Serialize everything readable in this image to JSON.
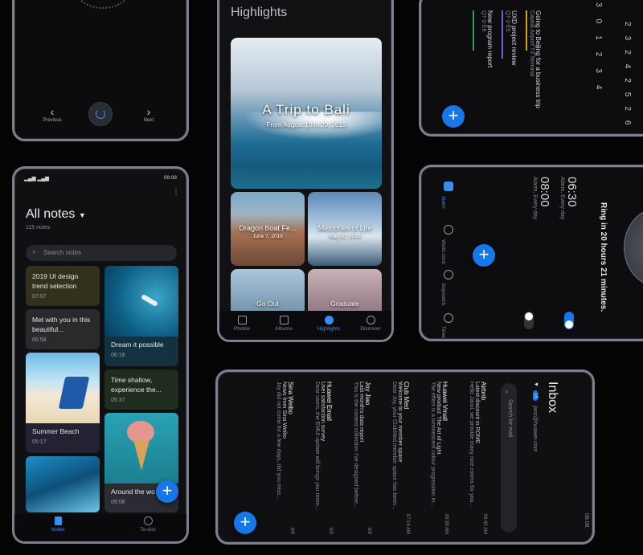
{
  "player": {
    "prev_label": "Previous",
    "next_label": "Next"
  },
  "notes": {
    "status_time": "08:08",
    "title": "All notes",
    "count": "115 notes",
    "search_placeholder": "Search notes",
    "items": [
      {
        "title": "2019 UI design trend selection",
        "date": "07:07"
      },
      {
        "title": "Met with you in this beautiful...",
        "date": "06:58"
      },
      {
        "title": "Summer Beach",
        "date": "05:17"
      },
      {
        "title": "Dream it possible",
        "date": "06:18"
      },
      {
        "title": "Time shallow, experience the...",
        "date": "05:37"
      },
      {
        "title": "Around the wo",
        "date": "09:08"
      }
    ],
    "tabs": {
      "notes": "Notes",
      "todos": "To-dos"
    }
  },
  "gallery": {
    "title": "Highlights",
    "hero_title": "A Trip to Bali",
    "hero_date": "From August 10 to 20, 2019",
    "cards": [
      {
        "title": "Dragon Boat Fe...",
        "date": "June 7, 2019"
      },
      {
        "title": "Memories of Life",
        "date": "May 20, 2019"
      },
      {
        "title": "Go Out",
        "date": ""
      },
      {
        "title": "Graduate",
        "date": ""
      }
    ],
    "tabs": {
      "photos": "Photos",
      "albums": "Albums",
      "highlights": "Highlights",
      "discover": "Discover"
    }
  },
  "calendar": {
    "events": [
      {
        "title": "Going to Beijing for a business trip",
        "sub": "Capital Airport T3 Terminal"
      },
      {
        "title": "UXD project review",
        "sub": "Q7-2-E5"
      },
      {
        "title": "New program report",
        "sub": "Q7-2-E6"
      }
    ],
    "days": [
      "30",
      "1",
      "2",
      "3",
      "4"
    ],
    "days2": [
      "23",
      "24",
      "25",
      "26",
      "27",
      "28"
    ]
  },
  "clock": {
    "alarms": [
      {
        "time": "06:30",
        "label": "Alarm, Every day"
      },
      {
        "time": "08:00",
        "label": "Alarm, Every day"
      }
    ],
    "ring_text": "Ring in 20 hours 21 minutes.",
    "tabs": {
      "alarm": "Alarm",
      "world": "World clock",
      "stopwatch": "Stopwatch",
      "timer": "Timer"
    }
  },
  "mail": {
    "title": "Inbox",
    "account": "jaoz@huawei.com",
    "badge": "15",
    "search_placeholder": "Search for mail",
    "status_time": "08:08",
    "messages": [
      {
        "sender": "Airbnb",
        "subject": "Latest discount in ROME",
        "preview": "Hello Jaoxi, we provide many nice rooms for you...",
        "time": "09:42 AM"
      },
      {
        "sender": "Huawei Vmall",
        "subject": "New product: The Art of Light",
        "preview": "The effect is a luminescent colour progression in...",
        "time": "09:39 AM"
      },
      {
        "sender": "Club Med",
        "subject": "Welcome to your member space",
        "preview": "Dear Joy, your ClubMed member space has been...",
        "time": "07:16 AM"
      },
      {
        "sender": "Joy Jiao",
        "subject": "Last month's data report",
        "preview": "This is the coolest collection I've designed before...",
        "time": "9/9"
      },
      {
        "sender": "Huawei Email",
        "subject": "User satisfaction survey",
        "preview": "Dear users, the EMUI update will brings you more...",
        "time": "9/9"
      },
      {
        "sender": "Sina Weibo",
        "subject": "News from Sina Weibo",
        "preview": "Joy did not come for a few days, did you miss...",
        "time": "9/9"
      }
    ]
  }
}
